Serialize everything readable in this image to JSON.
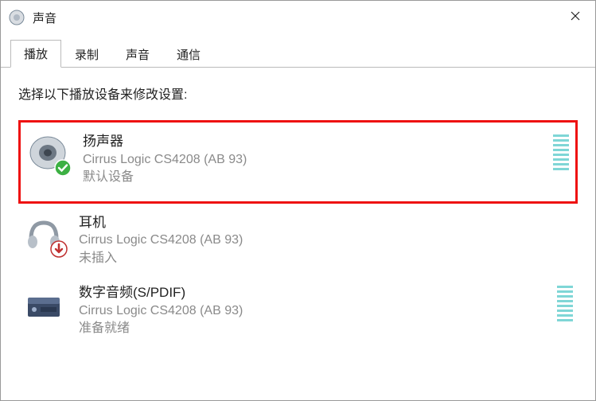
{
  "window": {
    "title": "声音"
  },
  "tabs": [
    {
      "label": "播放",
      "active": true
    },
    {
      "label": "录制",
      "active": false
    },
    {
      "label": "声音",
      "active": false
    },
    {
      "label": "通信",
      "active": false
    }
  ],
  "instruction": "选择以下播放设备来修改设置:",
  "devices": [
    {
      "name": "扬声器",
      "driver": "Cirrus Logic CS4208 (AB 93)",
      "status": "默认设备",
      "icon": "speaker-icon",
      "badge": "check",
      "highlighted": true,
      "meter": true
    },
    {
      "name": "耳机",
      "driver": "Cirrus Logic CS4208 (AB 93)",
      "status": "未插入",
      "icon": "headphones-icon",
      "badge": "down-arrow",
      "highlighted": false,
      "meter": false
    },
    {
      "name": "数字音频(S/PDIF)",
      "driver": "Cirrus Logic CS4208 (AB 93)",
      "status": "准备就绪",
      "icon": "spdif-icon",
      "badge": null,
      "highlighted": false,
      "meter": true
    }
  ]
}
